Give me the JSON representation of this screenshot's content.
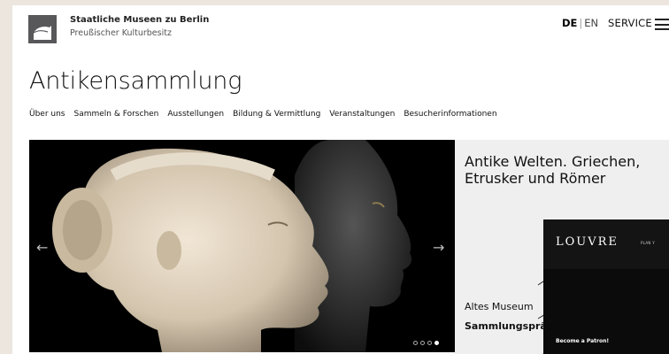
{
  "header": {
    "org_name": "Staatliche Museen zu Berlin",
    "org_sub": "Preußischer Kulturbesitz",
    "lang_active": "DE",
    "lang_sep": "|",
    "lang_other": "EN",
    "service": "SERVICE",
    "menu_icon": "hamburger-menu-icon"
  },
  "page_title": "Antikensammlung",
  "nav": [
    "Über uns",
    "Sammeln & Forschen",
    "Ausstellungen",
    "Bildung & Vermittlung",
    "Veranstaltungen",
    "Besucherinformationen"
  ],
  "hero": {
    "prev": "←",
    "next": "→",
    "slide_count": 4,
    "active_slide": 4
  },
  "panel": {
    "title": "Antike Welten. Griechen, Etrusker und Römer",
    "location": "Altes Museum",
    "collection": "Sammlungspräse"
  },
  "louvre": {
    "logo": "LOUVRE",
    "nav": "PLAN Y",
    "patron": "Become a Patron!"
  },
  "colors": {
    "background": "#ece6de",
    "panel": "#efefef",
    "logo": "#58585a"
  }
}
